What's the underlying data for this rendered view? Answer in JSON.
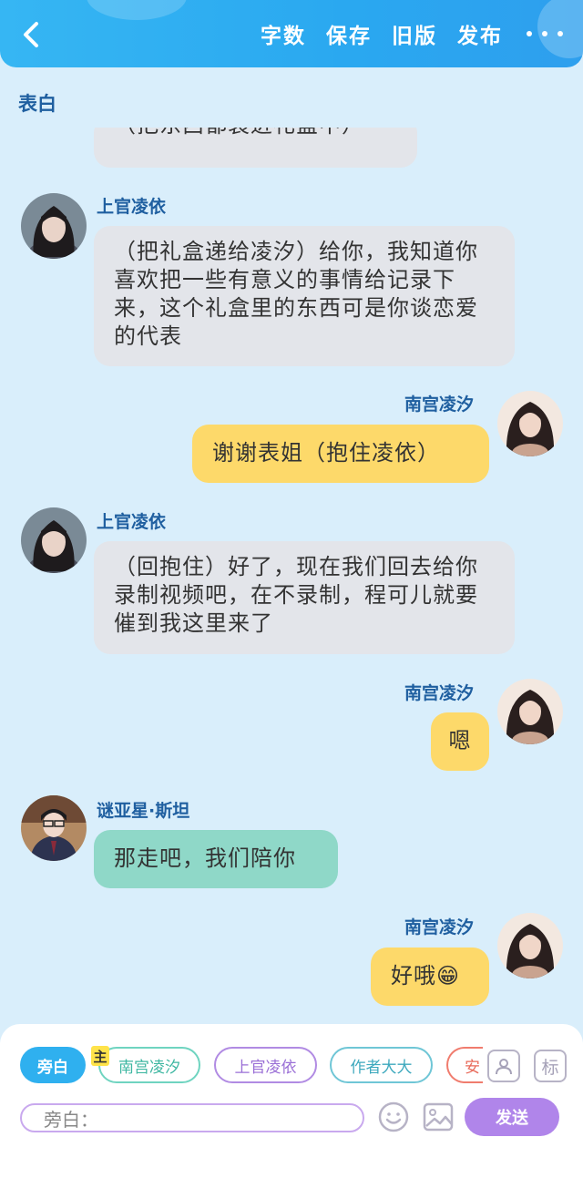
{
  "header": {
    "actions": [
      "字数",
      "保存",
      "旧版",
      "发布"
    ]
  },
  "section_title": "表白",
  "messages": [
    {
      "sender": "",
      "text": "（把东西都装进礼盒中）",
      "side": "left",
      "color": "gray"
    },
    {
      "sender": "上官凌依",
      "text": "（把礼盒递给凌汐）给你，我知道你喜欢把一些有意义的事情给记录下来，这个礼盒里的东西可是你谈恋爱的代表",
      "side": "left",
      "color": "gray"
    },
    {
      "sender": "南宫凌汐",
      "text": "谢谢表姐（抱住凌依）",
      "side": "right",
      "color": "yellow"
    },
    {
      "sender": "上官凌依",
      "text": "（回抱住）好了，现在我们回去给你录制视频吧，在不录制，程可儿就要催到我这里来了",
      "side": "left",
      "color": "gray"
    },
    {
      "sender": "南宫凌汐",
      "text": "嗯",
      "side": "right",
      "color": "yellow"
    },
    {
      "sender": "谜亚星·斯坦",
      "text": "那走吧，我们陪你",
      "side": "left",
      "color": "teal"
    },
    {
      "sender": "南宫凌汐",
      "text": "好哦😁",
      "side": "right",
      "color": "yellow"
    }
  ],
  "panel": {
    "chips": [
      "旁白",
      "南宫凌汐",
      "上官凌依",
      "作者大大",
      "安"
    ],
    "main_tag": "主",
    "tool_tag_label": "标",
    "input_prefix": "旁白：",
    "input_value": "",
    "send_label": "发送"
  },
  "colors": {
    "header": "#2aa8f0",
    "sender_name": "#1f5fa0",
    "bubble_gray": "#e3e5ea",
    "bubble_yellow": "#fdd96a",
    "bubble_teal": "#8fd8c8",
    "send_button": "#b085ea"
  },
  "icons": [
    "back-arrow-icon",
    "more-icon",
    "emoji-icon",
    "image-icon",
    "person-card-icon"
  ]
}
